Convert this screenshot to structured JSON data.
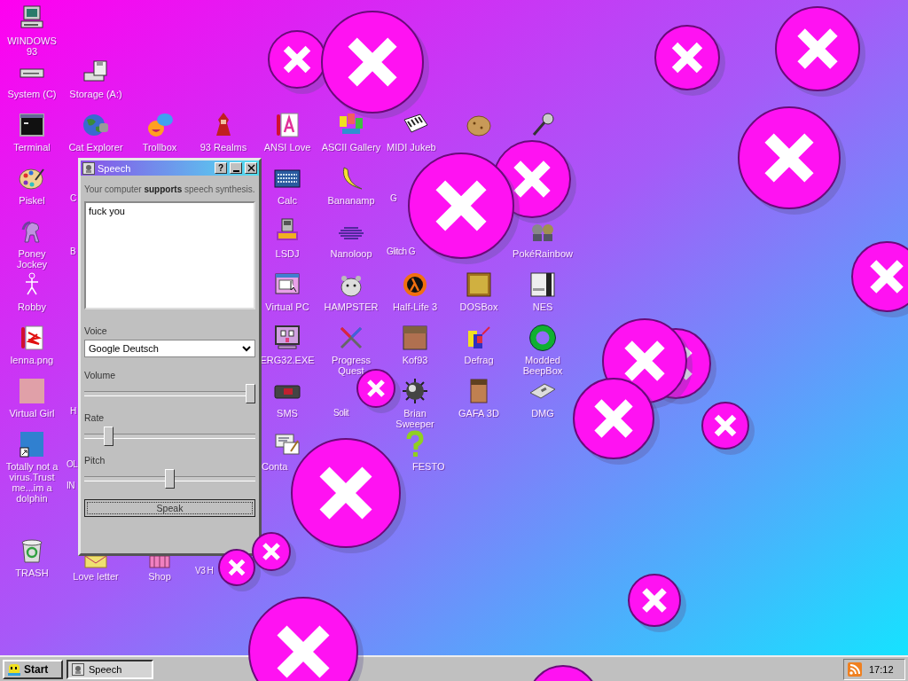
{
  "desktop": {
    "icons": [
      {
        "label": "WINDOWS 93",
        "kind": "icon"
      },
      {
        "label": "System (C)",
        "kind": "icon"
      },
      {
        "label": "Storage (A:)",
        "kind": "icon"
      },
      {
        "label": "Terminal",
        "kind": "icon"
      },
      {
        "label": "Cat Explorer",
        "kind": "icon"
      },
      {
        "label": "Trollbox",
        "kind": "icon"
      },
      {
        "label": "93 Realms",
        "kind": "icon"
      },
      {
        "label": "ANSI Love",
        "kind": "icon"
      },
      {
        "label": "ASCII Gallery",
        "kind": "icon"
      },
      {
        "label": "MIDI Jukeb",
        "kind": "partial"
      },
      {
        "label": "Piskel",
        "kind": "icon"
      },
      {
        "label": "C",
        "kind": "fragment"
      },
      {
        "label": "Calc",
        "kind": "icon"
      },
      {
        "label": "Bananamp",
        "kind": "icon"
      },
      {
        "label": "G",
        "kind": "fragment"
      },
      {
        "label": "Poney Jockey",
        "kind": "icon"
      },
      {
        "label": "B",
        "kind": "fragment"
      },
      {
        "label": "LSDJ",
        "kind": "icon"
      },
      {
        "label": "Nanoloop",
        "kind": "icon"
      },
      {
        "label": "Glitch G",
        "kind": "fragment"
      },
      {
        "label": "PokéRainbow",
        "kind": "icon"
      },
      {
        "label": "Robby",
        "kind": "icon"
      },
      {
        "label": "Virtual PC",
        "kind": "icon"
      },
      {
        "label": "HAMPSTER",
        "kind": "icon"
      },
      {
        "label": "Half-Life 3",
        "kind": "icon"
      },
      {
        "label": "DOSBox",
        "kind": "icon"
      },
      {
        "label": "NES",
        "kind": "icon"
      },
      {
        "label": "lenna.png",
        "kind": "icon"
      },
      {
        "label": "ERG32.EXE",
        "kind": "icon"
      },
      {
        "label": "Progress Quest",
        "kind": "icon"
      },
      {
        "label": "Kof93",
        "kind": "icon"
      },
      {
        "label": "Defrag",
        "kind": "icon"
      },
      {
        "label": "Modded BeepBox",
        "kind": "icon"
      },
      {
        "label": "Virtual Girl",
        "kind": "icon"
      },
      {
        "label": "H",
        "kind": "fragment"
      },
      {
        "label": "SMS",
        "kind": "icon"
      },
      {
        "label": "Solit",
        "kind": "fragment"
      },
      {
        "label": "Brian Sweeper",
        "kind": "icon"
      },
      {
        "label": "GAFA 3D",
        "kind": "icon"
      },
      {
        "label": "DMG",
        "kind": "icon"
      },
      {
        "label": "Totally not a virus.Trust me...im a dolphin",
        "kind": "icon"
      },
      {
        "label": "OL",
        "kind": "fragment"
      },
      {
        "label": "IN",
        "kind": "fragment"
      },
      {
        "label": "Conta",
        "kind": "partial"
      },
      {
        "label": "FESTO",
        "kind": "partial"
      },
      {
        "label": "TRASH",
        "kind": "icon"
      },
      {
        "label": "Love letter",
        "kind": "icon"
      },
      {
        "label": "Shop",
        "kind": "icon"
      },
      {
        "label": "V3 H",
        "kind": "fragment"
      }
    ]
  },
  "window": {
    "title": "Speech",
    "help_button": "?",
    "description": "Your computer **supports** speech synthesis.",
    "text": "fuck you",
    "voice_label": "Voice",
    "voice": "Google Deutsch",
    "sliders": [
      {
        "label": "Volume",
        "level": 1.0
      },
      {
        "label": "Rate",
        "level": 0.12
      },
      {
        "label": "Pitch",
        "level": 0.5
      }
    ],
    "button": "Speak"
  },
  "taskbar": {
    "start": "Start",
    "tasks": [
      {
        "label": "Speech",
        "selected": true
      }
    ],
    "clock": "17:12"
  }
}
